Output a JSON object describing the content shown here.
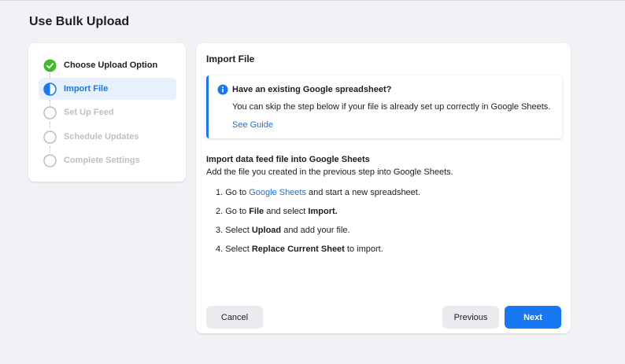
{
  "page_title": "Use Bulk Upload",
  "steps": [
    {
      "label": "Choose Upload Option",
      "state": "done"
    },
    {
      "label": "Import File",
      "state": "active"
    },
    {
      "label": "Set Up Feed",
      "state": "pending"
    },
    {
      "label": "Schedule Updates",
      "state": "pending"
    },
    {
      "label": "Complete Settings",
      "state": "pending"
    }
  ],
  "card": {
    "title": "Import File",
    "notice": {
      "title": "Have an existing Google spreadsheet?",
      "body": "You can skip the step below if your file is already set up correctly in Google Sheets.",
      "link": "See Guide"
    },
    "section_heading": "Import data feed file into Google Sheets",
    "section_sub": "Add the file you created in the previous step into Google Sheets.",
    "instructions": {
      "s1": {
        "num": "1. Go to ",
        "link": "Google Sheets",
        "rest": " and start a new spreadsheet."
      },
      "s2": {
        "num": "2. Go to ",
        "b1": "File",
        "mid": " and select ",
        "b2": "Import."
      },
      "s3": {
        "num": "3. Select ",
        "b1": "Upload",
        "rest": " and add your file."
      },
      "s4": {
        "num": "4. Select ",
        "b1": "Replace Current Sheet",
        "rest": " to import."
      }
    }
  },
  "buttons": {
    "cancel": "Cancel",
    "previous": "Previous",
    "next": "Next"
  },
  "colors": {
    "accent": "#1877f2",
    "success": "#42b72a",
    "pending": "#bcc0c4"
  }
}
